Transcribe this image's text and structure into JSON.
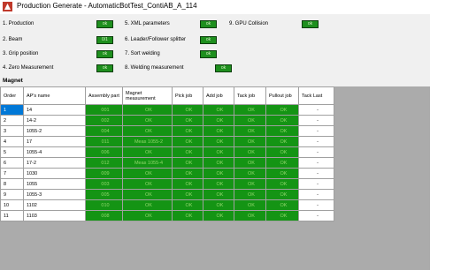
{
  "window": {
    "title": "Production Generate - AutomaticBotTest_ContiAB_A_114"
  },
  "steps": [
    {
      "label": "1. Production",
      "status": "ok"
    },
    {
      "label": "2. Beam",
      "status": "0/1"
    },
    {
      "label": "3. Grip position",
      "status": "ok"
    },
    {
      "label": "4. Zero Measurement",
      "status": "ok"
    },
    {
      "label": "5. XML parameters",
      "status": "ok"
    },
    {
      "label": "6. Leader/Follower splitter",
      "status": "ok"
    },
    {
      "label": "7. Sort welding",
      "status": "ok"
    },
    {
      "label": "8. Welding measurement",
      "status": "ok"
    },
    {
      "label": "9. GPU Collision",
      "status": "ok"
    }
  ],
  "section_title": "Magnet",
  "table": {
    "columns": [
      "Order",
      "AP's name",
      "Assembly part",
      "Magnet measurement",
      "Pick job",
      "Add job",
      "Tack job",
      "Pullout job",
      "Tack Last"
    ],
    "rows": [
      [
        "1",
        "14",
        "001",
        "OK",
        "OK",
        "OK",
        "OK",
        "OK",
        "-"
      ],
      [
        "2",
        "14-2",
        "002",
        "OK",
        "OK",
        "OK",
        "OK",
        "OK",
        "-"
      ],
      [
        "3",
        "1055-2",
        "004",
        "OK",
        "OK",
        "OK",
        "OK",
        "OK",
        "-"
      ],
      [
        "4",
        "17",
        "011",
        "Meas 1055-2",
        "OK",
        "OK",
        "OK",
        "OK",
        "-"
      ],
      [
        "5",
        "1055-4",
        "006",
        "OK",
        "OK",
        "OK",
        "OK",
        "OK",
        "-"
      ],
      [
        "6",
        "17-2",
        "012",
        "Meas 1055-4",
        "OK",
        "OK",
        "OK",
        "OK",
        "-"
      ],
      [
        "7",
        "1030",
        "009",
        "OK",
        "OK",
        "OK",
        "OK",
        "OK",
        "-"
      ],
      [
        "8",
        "1055",
        "003",
        "OK",
        "OK",
        "OK",
        "OK",
        "OK",
        "-"
      ],
      [
        "9",
        "1055-3",
        "005",
        "OK",
        "OK",
        "OK",
        "OK",
        "OK",
        "-"
      ],
      [
        "10",
        "1102",
        "010",
        "OK",
        "OK",
        "OK",
        "OK",
        "OK",
        "-"
      ],
      [
        "11",
        "1103",
        "008",
        "OK",
        "OK",
        "OK",
        "OK",
        "OK",
        "-"
      ]
    ],
    "selected_row": 0
  },
  "colors": {
    "ok_green": "#149414",
    "selection_blue": "#0078d7",
    "grid_background": "#ababab"
  }
}
